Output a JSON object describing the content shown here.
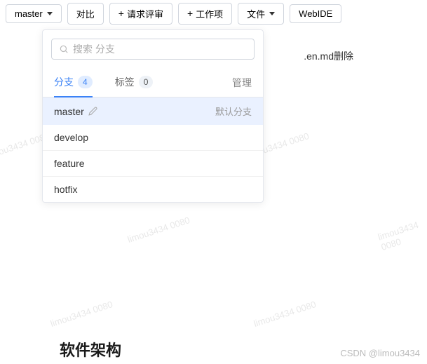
{
  "toolbar": {
    "branch_selector": "master",
    "compare": "对比",
    "request_review": "请求评审",
    "work_item": "工作项",
    "files": "文件",
    "webide": "WebIDE"
  },
  "dropdown": {
    "search_placeholder": "搜索 分支",
    "tabs": {
      "branches_label": "分支",
      "branches_count": "4",
      "tags_label": "标签",
      "tags_count": "0",
      "manage": "管理"
    },
    "default_badge": "默认分支",
    "branches": [
      {
        "name": "master",
        "default": true,
        "editable": true
      },
      {
        "name": "develop",
        "default": false
      },
      {
        "name": "feature",
        "default": false
      },
      {
        "name": "hotfix",
        "default": false
      }
    ]
  },
  "background": {
    "row_text": ".en.md删除"
  },
  "section": {
    "title": "软件架构"
  },
  "watermark": "limou3434 0080",
  "credit": "CSDN @limou3434"
}
